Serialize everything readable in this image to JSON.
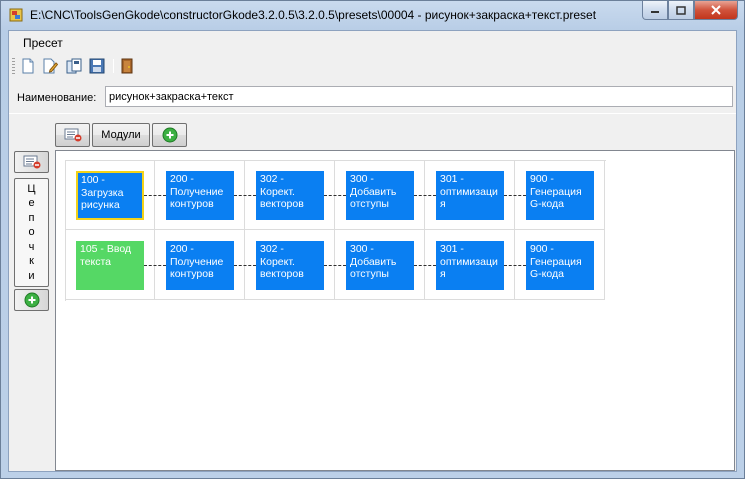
{
  "window": {
    "title": "E:\\CNC\\ToolsGenGkode\\constructorGkode3.2.0.5\\3.2.0.5\\presets\\00004 - рисунок+закраска+текст.preset"
  },
  "menu": {
    "items": [
      "Пресет"
    ]
  },
  "toolbar": {
    "icons": [
      "new-file-icon",
      "edit-file-icon",
      "copy-icon",
      "save-icon",
      "exit-door-icon"
    ]
  },
  "name_field": {
    "label": "Наименование:",
    "value": "рисунок+закраска+текст"
  },
  "top_buttons": {
    "modules_label": "Модули"
  },
  "side_tab": {
    "letters": [
      "Ц",
      "е",
      "п",
      "о",
      "ч",
      "к",
      "и"
    ]
  },
  "chains": [
    [
      {
        "label": "100 - Загрузка рисунка",
        "color": "#0a7ff2",
        "selected": true
      },
      {
        "label": "200 - Получение контуров",
        "color": "#0a7ff2"
      },
      {
        "label": "302 - Корект. векторов",
        "color": "#0a7ff2"
      },
      {
        "label": "300 - Добавить отступы",
        "color": "#0a7ff2"
      },
      {
        "label": "301 - оптимизаци я",
        "color": "#0a7ff2"
      },
      {
        "label": "900 - Генерация G-кода",
        "color": "#0a7ff2"
      }
    ],
    [
      {
        "label": "105 - Ввод текста",
        "color": "#55d865"
      },
      {
        "label": "200 - Получение контуров",
        "color": "#0a7ff2"
      },
      {
        "label": "302 - Корект. векторов",
        "color": "#0a7ff2"
      },
      {
        "label": "300 - Добавить отступы",
        "color": "#0a7ff2"
      },
      {
        "label": "301 - оптимизаци я",
        "color": "#0a7ff2"
      },
      {
        "label": "900 - Генерация G-кода",
        "color": "#0a7ff2"
      }
    ]
  ]
}
